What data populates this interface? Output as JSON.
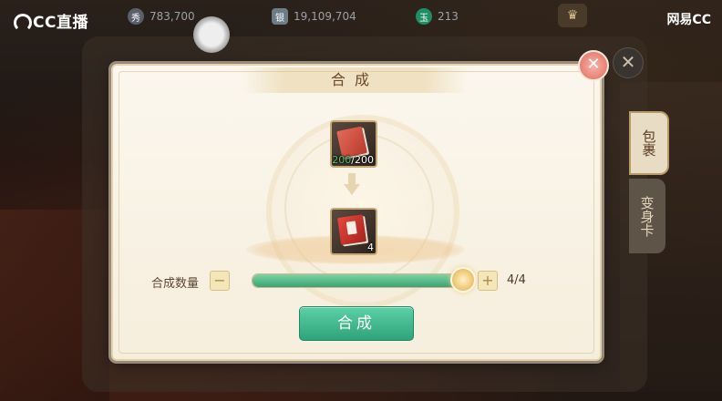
{
  "topbar": {
    "brand": "CC直播",
    "resources": [
      {
        "icon": "coin-icon",
        "glyph": "秀",
        "value": "783,700"
      },
      {
        "icon": "silver-icon",
        "glyph": "银",
        "value": "19,109,704"
      },
      {
        "icon": "jade-icon",
        "glyph": "玉",
        "value": "213"
      }
    ],
    "watermark": "网易CC"
  },
  "side_tabs": [
    {
      "label": "包裹",
      "active": true
    },
    {
      "label": "变身卡",
      "active": false
    }
  ],
  "dialog": {
    "title": "合成",
    "source_item": {
      "name": "red-book",
      "have": "200",
      "need": "/200"
    },
    "target_item": {
      "name": "red-book-bundle",
      "count": "4"
    },
    "quantity": {
      "label": "合成数量",
      "minus": "−",
      "plus": "+",
      "current": 4,
      "max": 4,
      "display": "4/4"
    },
    "confirm_label": "合成"
  },
  "colors": {
    "accent_green": "#2ea37a",
    "dialog_bg": "#fbf7ee",
    "close_red": "#e06b5f"
  }
}
